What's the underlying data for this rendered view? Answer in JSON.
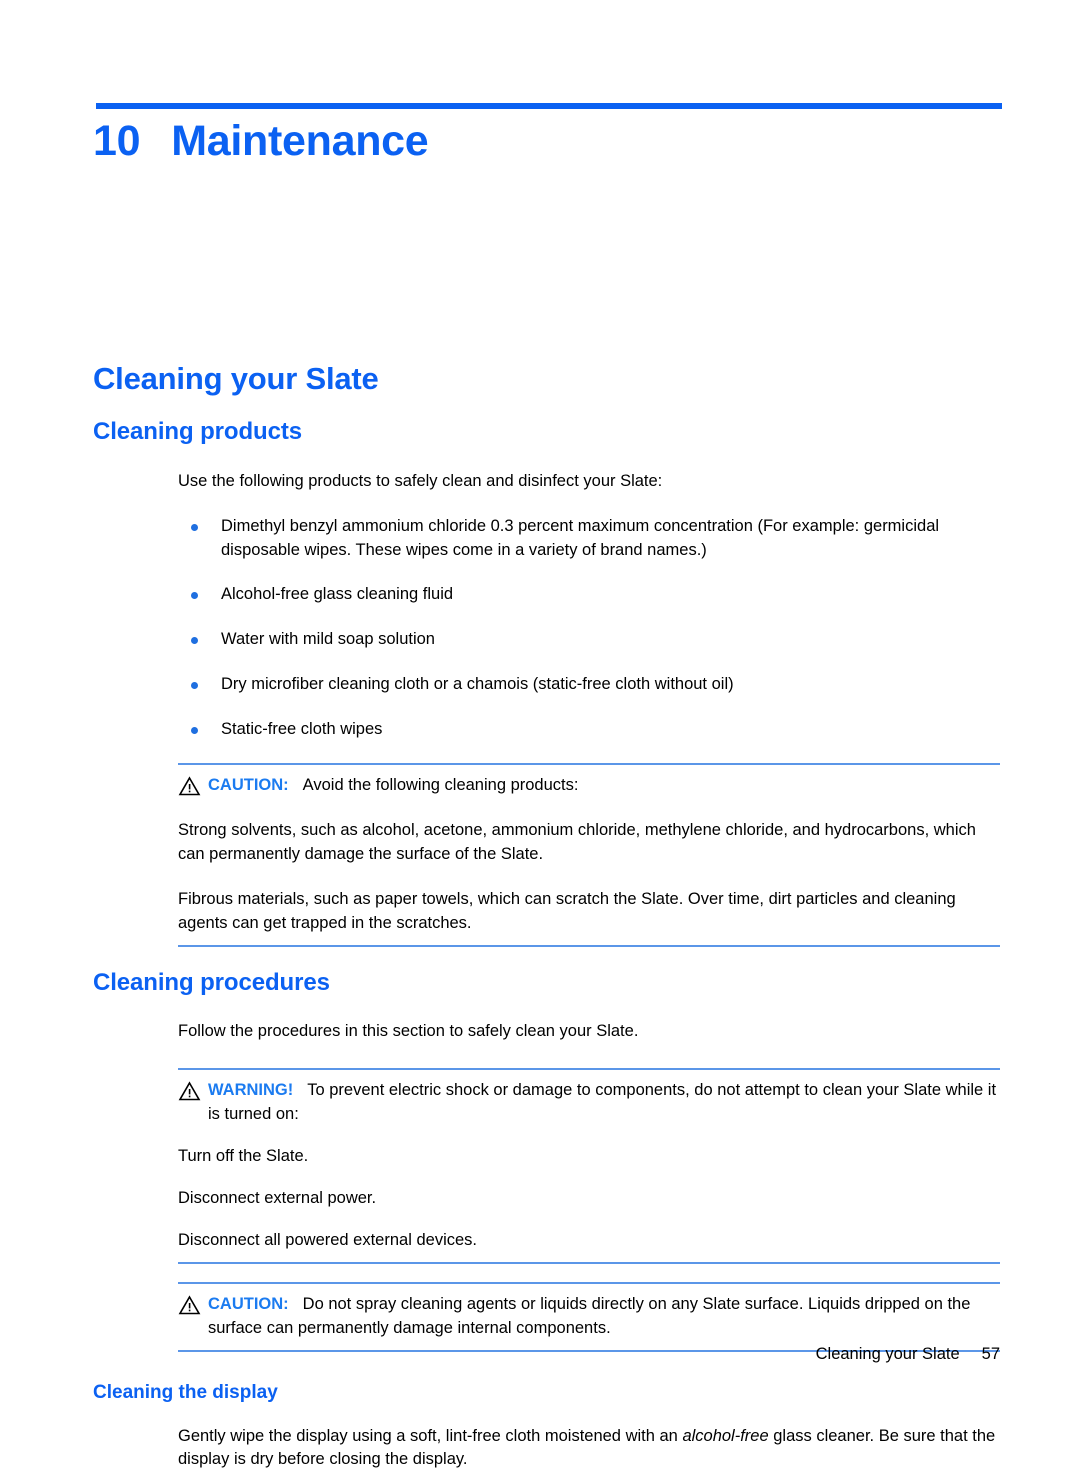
{
  "document": {
    "chapter_number": "10",
    "chapter_title": "Maintenance",
    "accent_color": "#0B61F2",
    "rule_color": "#5B96E8",
    "bullet_color": "#1F6FE0"
  },
  "section": {
    "h1": "Cleaning your Slate",
    "cleaning_products": {
      "heading": "Cleaning products",
      "intro": "Use the following products to safely clean and disinfect your Slate:",
      "bullets": [
        "Dimethyl benzyl ammonium chloride 0.3 percent maximum concentration (For example: germicidal disposable wipes. These wipes come in a variety of brand names.)",
        "Alcohol-free glass cleaning fluid",
        "Water with mild soap solution",
        "Dry microfiber cleaning cloth or a chamois (static-free cloth without oil)",
        "Static-free cloth wipes"
      ],
      "caution": {
        "icon": "warning-triangle-icon",
        "label": "CAUTION:",
        "lead": "Avoid the following cleaning products:",
        "paragraphs": [
          "Strong solvents, such as alcohol, acetone, ammonium chloride, methylene chloride, and hydrocarbons, which can permanently damage the surface of the Slate.",
          "Fibrous materials, such as paper towels, which can scratch the Slate. Over time, dirt particles and cleaning agents can get trapped in the scratches."
        ]
      }
    },
    "cleaning_procedures": {
      "heading": "Cleaning procedures",
      "intro": "Follow the procedures in this section to safely clean your Slate.",
      "warning": {
        "icon": "warning-triangle-icon",
        "label": "WARNING!",
        "lead": "To prevent electric shock or damage to components, do not attempt to clean your Slate while it is turned on:",
        "steps": [
          "Turn off the Slate.",
          "Disconnect external power.",
          "Disconnect all powered external devices."
        ]
      },
      "caution": {
        "icon": "warning-triangle-icon",
        "label": "CAUTION:",
        "lead": "Do not spray cleaning agents or liquids directly on any Slate surface. Liquids dripped on the surface can permanently damage internal components."
      },
      "cleaning_the_display": {
        "heading": "Cleaning the display",
        "text_before_italic": "Gently wipe the display using a soft, lint-free cloth moistened with an ",
        "italic_phrase": "alcohol-free",
        "text_after_italic": " glass cleaner. Be sure that the display is dry before closing the display."
      }
    }
  },
  "footer": {
    "text": "Cleaning your Slate",
    "page_number": "57"
  }
}
